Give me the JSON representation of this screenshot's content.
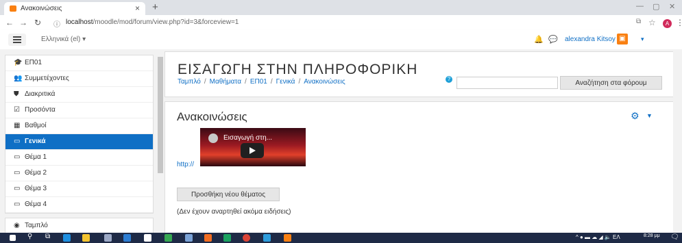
{
  "browser": {
    "tab_title": "Ανακοινώσεις",
    "tab_close": "×",
    "new_tab": "+",
    "url_host": "localhost",
    "url_path": "/moodle/mod/forum/view.php?id=3&forceview=1",
    "minimize": "—",
    "restore": "▢",
    "close": "✕",
    "profile_initial": "A"
  },
  "navbar": {
    "language": "Ελληνικά (el) ▾",
    "username": "alexandra Kitsoy",
    "user_caret": "▾"
  },
  "drawer": {
    "items": [
      {
        "label": "ΕΠ01",
        "icon": "graduation-cap-icon",
        "glyph": "🎓"
      },
      {
        "label": "Συμμετέχοντες",
        "icon": "users-icon",
        "glyph": "👥"
      },
      {
        "label": "Διακριτικά",
        "icon": "shield-icon",
        "glyph": "⛊"
      },
      {
        "label": "Προσόντα",
        "icon": "check-square-icon",
        "glyph": "☑"
      },
      {
        "label": "Βαθμοί",
        "icon": "table-icon",
        "glyph": "▦"
      },
      {
        "label": "Γενικά",
        "icon": "folder-icon",
        "glyph": "▭",
        "active": true
      },
      {
        "label": "Θέμα 1",
        "icon": "folder-icon",
        "glyph": "▭"
      },
      {
        "label": "Θέμα 2",
        "icon": "folder-icon",
        "glyph": "▭"
      },
      {
        "label": "Θέμα 3",
        "icon": "folder-icon",
        "glyph": "▭"
      },
      {
        "label": "Θέμα 4",
        "icon": "folder-icon",
        "glyph": "▭"
      }
    ],
    "home_item": {
      "label": "Ταμπλό",
      "icon": "tachometer-icon",
      "glyph": "◉"
    }
  },
  "header": {
    "course_title": "ΕΙΣΑΓΩΓΗ ΣΤΗΝ ΠΛΗΡΟΦΟΡΙΚΗ",
    "breadcrumb": [
      "Ταμπλό",
      "Μαθήματα",
      "ΕΠ01",
      "Γενικά",
      "Ανακοινώσεις"
    ],
    "search_button": "Αναζήτηση στα φόρουμ",
    "search_value": ""
  },
  "main": {
    "forum_title": "Ανακοινώσεις",
    "video_title": "Εισαγωγή στη...",
    "link_text": "http://",
    "add_topic_button": "Προσθήκη νέου θέματος",
    "no_posts": "(Δεν έχουν αναρτηθεί ακόμα ειδήσεις)"
  },
  "taskbar": {
    "tray_lang": "ΕΛ",
    "time": "8:28 μμ"
  },
  "colors": {
    "accent": "#0f6fc5",
    "brand": "#f98012",
    "taskbar": "#1e2a46"
  }
}
